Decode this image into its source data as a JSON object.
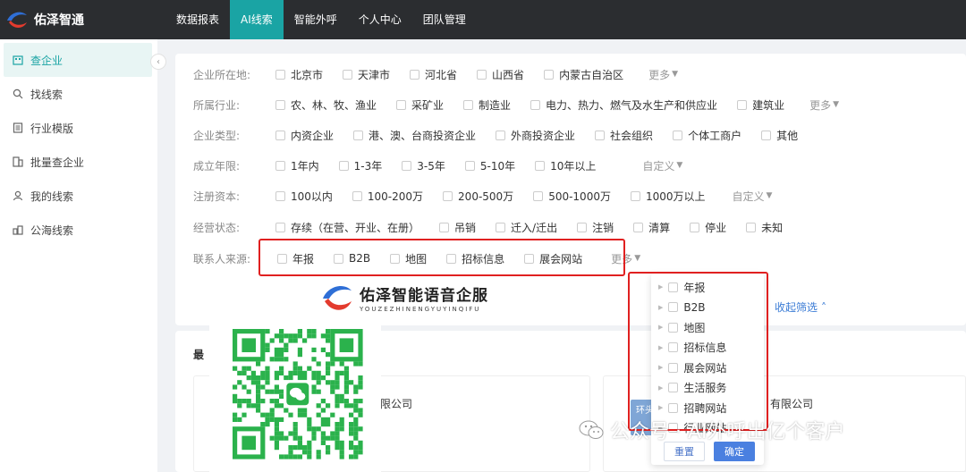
{
  "app": {
    "title": "佑泽智通"
  },
  "nav": [
    {
      "label": "数据报表",
      "active": false
    },
    {
      "label": "AI线索",
      "active": true
    },
    {
      "label": "智能外呼",
      "active": false
    },
    {
      "label": "个人中心",
      "active": false
    },
    {
      "label": "团队管理",
      "active": false
    }
  ],
  "sidebar": {
    "items": [
      {
        "label": "查企业",
        "icon": "building-icon",
        "active": true
      },
      {
        "label": "找线索",
        "icon": "search-icon",
        "active": false
      },
      {
        "label": "行业模版",
        "icon": "template-icon",
        "active": false
      },
      {
        "label": "批量查企业",
        "icon": "batch-icon",
        "active": false
      },
      {
        "label": "我的线索",
        "icon": "user-icon",
        "active": false
      },
      {
        "label": "公海线索",
        "icon": "pool-icon",
        "active": false
      }
    ]
  },
  "filters": {
    "location": {
      "label": "企业所在地:",
      "options": [
        "北京市",
        "天津市",
        "河北省",
        "山西省",
        "内蒙古自治区"
      ],
      "more": "更多"
    },
    "industry": {
      "label": "所属行业:",
      "options": [
        "农、林、牧、渔业",
        "采矿业",
        "制造业",
        "电力、热力、燃气及水生产和供应业",
        "建筑业"
      ],
      "more": "更多"
    },
    "type": {
      "label": "企业类型:",
      "options": [
        "内资企业",
        "港、澳、台商投资企业",
        "外商投资企业",
        "社会组织",
        "个体工商户",
        "其他"
      ]
    },
    "age": {
      "label": "成立年限:",
      "options": [
        "1年内",
        "1-3年",
        "3-5年",
        "5-10年",
        "10年以上"
      ],
      "more": "自定义"
    },
    "capital": {
      "label": "注册资本:",
      "options": [
        "100以内",
        "100-200万",
        "200-500万",
        "500-1000万",
        "1000万以上"
      ],
      "more": "自定义"
    },
    "status": {
      "label": "经营状态:",
      "options": [
        "存续（在营、开业、在册）",
        "吊销",
        "迁入/迁出",
        "注销",
        "清算",
        "停业",
        "未知"
      ]
    },
    "source": {
      "label": "联系人来源:",
      "options": [
        "年报",
        "B2B",
        "地图",
        "招标信息",
        "展会网站"
      ],
      "more": "更多"
    }
  },
  "dropdown": {
    "items": [
      "年报",
      "B2B",
      "地图",
      "招标信息",
      "展会网站",
      "生活服务",
      "招聘网站",
      "行业网站"
    ],
    "reset": "重置",
    "confirm": "确定"
  },
  "collapse_filter": "收起筛选",
  "lower": {
    "recent_title": "最",
    "card1_name": "限公司",
    "card2_name": "有限公司",
    "card2_avatar": "环头"
  },
  "brand": {
    "name": "佑泽智能语音企服",
    "pinyin": "YOUZEZHINENGYUYINQIFU"
  },
  "watermark": "公众号 · AI外呼出亿个客户",
  "colors": {
    "accent": "#1aa4a4",
    "highlight": "#e02020",
    "primary": "#4a80e0"
  }
}
